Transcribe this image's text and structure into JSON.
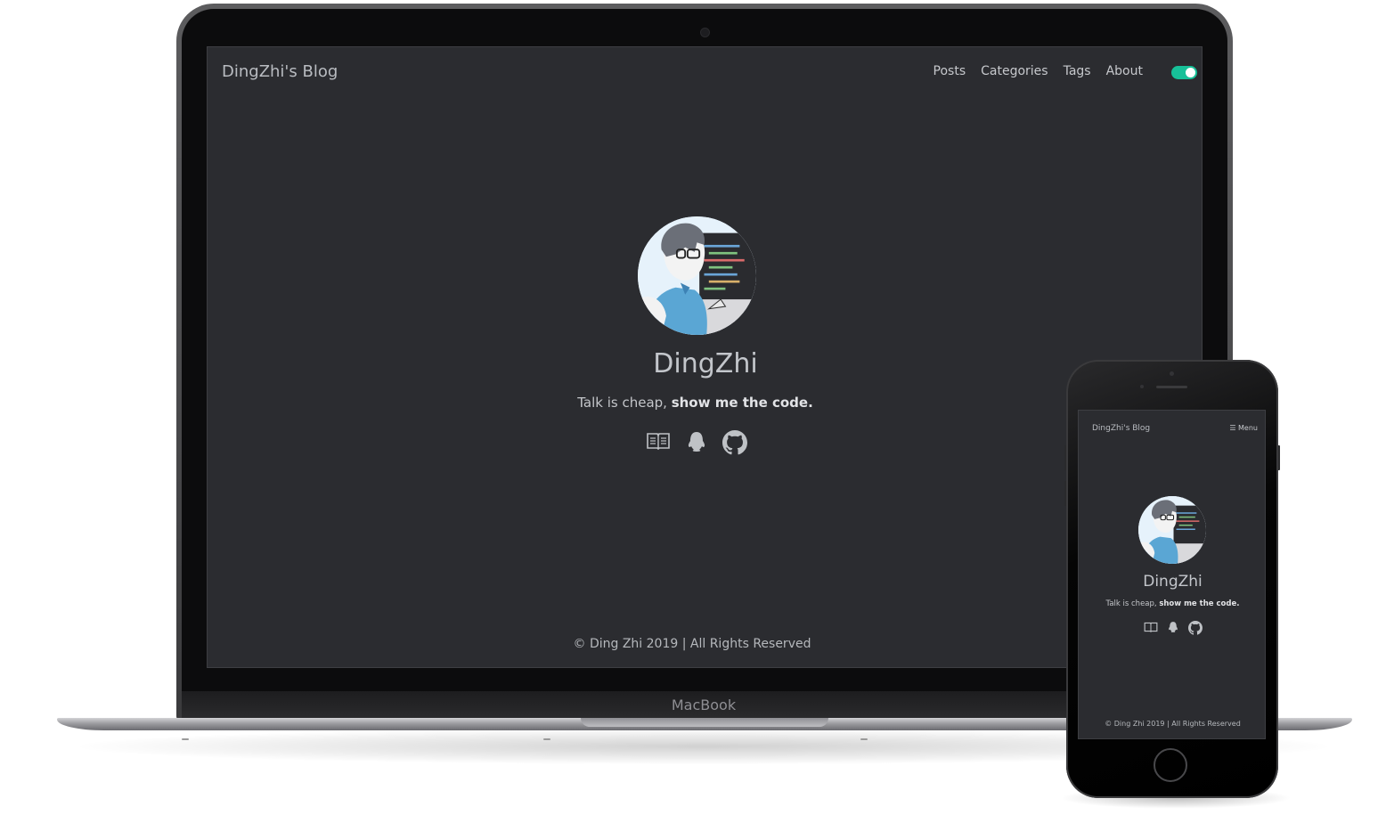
{
  "site": {
    "title": "DingZhi's Blog",
    "nav": [
      "Posts",
      "Categories",
      "Tags",
      "About"
    ],
    "theme_toggle": {
      "on": true,
      "color": "#17c098"
    },
    "author": "DingZhi",
    "motto_plain": "Talk is cheap, ",
    "motto_bold": "show me the code.",
    "social_icons": [
      "book-icon",
      "qq-penguin-icon",
      "github-icon"
    ],
    "footer": "© Ding Zhi 2019 | All Rights Reserved"
  },
  "mobile": {
    "title": "DingZhi's Blog",
    "menu_label": "☰ Menu"
  },
  "devices": {
    "laptop_brand": "MacBook"
  },
  "colors": {
    "page_background": "#2b2c30",
    "accent": "#17c098",
    "text": "#c3c6cb"
  }
}
